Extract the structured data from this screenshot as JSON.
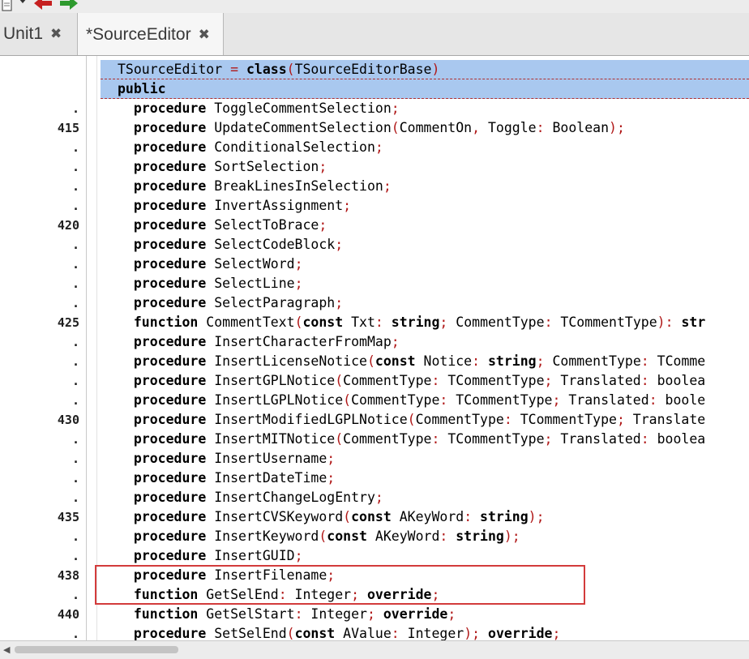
{
  "tabs": [
    {
      "label": "Unit1",
      "active": false
    },
    {
      "label": "*SourceEditor",
      "active": true
    }
  ],
  "editor": {
    "lines": [
      {
        "num": "",
        "highlight": true,
        "tokens": [
          [
            "id",
            "TSourceEditor "
          ],
          [
            "sym",
            "="
          ],
          [
            "id",
            " "
          ],
          [
            "kw",
            "class"
          ],
          [
            "sym",
            "("
          ],
          [
            "id",
            "TSourceEditorBase"
          ],
          [
            "sym",
            ")"
          ]
        ]
      },
      {
        "num": "",
        "highlight": true,
        "tokens": [
          [
            "kw",
            "public"
          ]
        ]
      },
      {
        "num": ".",
        "tokens": [
          [
            "kw",
            "  procedure "
          ],
          [
            "id",
            "ToggleCommentSelection"
          ],
          [
            "sym",
            ";"
          ]
        ]
      },
      {
        "num": "415",
        "tokens": [
          [
            "kw",
            "  procedure "
          ],
          [
            "id",
            "UpdateCommentSelection"
          ],
          [
            "sym",
            "("
          ],
          [
            "id",
            "CommentOn"
          ],
          [
            "sym",
            ","
          ],
          [
            "id",
            " Toggle"
          ],
          [
            "sym",
            ":"
          ],
          [
            "id",
            " Boolean"
          ],
          [
            "sym",
            ");"
          ]
        ]
      },
      {
        "num": ".",
        "tokens": [
          [
            "kw",
            "  procedure "
          ],
          [
            "id",
            "ConditionalSelection"
          ],
          [
            "sym",
            ";"
          ]
        ]
      },
      {
        "num": ".",
        "tokens": [
          [
            "kw",
            "  procedure "
          ],
          [
            "id",
            "SortSelection"
          ],
          [
            "sym",
            ";"
          ]
        ]
      },
      {
        "num": ".",
        "tokens": [
          [
            "kw",
            "  procedure "
          ],
          [
            "id",
            "BreakLinesInSelection"
          ],
          [
            "sym",
            ";"
          ]
        ]
      },
      {
        "num": ".",
        "tokens": [
          [
            "kw",
            "  procedure "
          ],
          [
            "id",
            "InvertAssignment"
          ],
          [
            "sym",
            ";"
          ]
        ]
      },
      {
        "num": "420",
        "tokens": [
          [
            "kw",
            "  procedure "
          ],
          [
            "id",
            "SelectToBrace"
          ],
          [
            "sym",
            ";"
          ]
        ]
      },
      {
        "num": ".",
        "tokens": [
          [
            "kw",
            "  procedure "
          ],
          [
            "id",
            "SelectCodeBlock"
          ],
          [
            "sym",
            ";"
          ]
        ]
      },
      {
        "num": ".",
        "tokens": [
          [
            "kw",
            "  procedure "
          ],
          [
            "id",
            "SelectWord"
          ],
          [
            "sym",
            ";"
          ]
        ]
      },
      {
        "num": ".",
        "tokens": [
          [
            "kw",
            "  procedure "
          ],
          [
            "id",
            "SelectLine"
          ],
          [
            "sym",
            ";"
          ]
        ]
      },
      {
        "num": ".",
        "tokens": [
          [
            "kw",
            "  procedure "
          ],
          [
            "id",
            "SelectParagraph"
          ],
          [
            "sym",
            ";"
          ]
        ]
      },
      {
        "num": "425",
        "tokens": [
          [
            "kw",
            "  function "
          ],
          [
            "id",
            "CommentText"
          ],
          [
            "sym",
            "("
          ],
          [
            "kw",
            "const"
          ],
          [
            "id",
            " Txt"
          ],
          [
            "sym",
            ":"
          ],
          [
            "kw",
            " string"
          ],
          [
            "sym",
            ";"
          ],
          [
            "id",
            " CommentType"
          ],
          [
            "sym",
            ":"
          ],
          [
            "id",
            " TCommentType"
          ],
          [
            "sym",
            "):"
          ],
          [
            "kw",
            " str"
          ]
        ]
      },
      {
        "num": ".",
        "tokens": [
          [
            "kw",
            "  procedure "
          ],
          [
            "id",
            "InsertCharacterFromMap"
          ],
          [
            "sym",
            ";"
          ]
        ]
      },
      {
        "num": ".",
        "tokens": [
          [
            "kw",
            "  procedure "
          ],
          [
            "id",
            "InsertLicenseNotice"
          ],
          [
            "sym",
            "("
          ],
          [
            "kw",
            "const"
          ],
          [
            "id",
            " Notice"
          ],
          [
            "sym",
            ":"
          ],
          [
            "kw",
            " string"
          ],
          [
            "sym",
            ";"
          ],
          [
            "id",
            " CommentType"
          ],
          [
            "sym",
            ":"
          ],
          [
            "id",
            " TComme"
          ]
        ]
      },
      {
        "num": ".",
        "tokens": [
          [
            "kw",
            "  procedure "
          ],
          [
            "id",
            "InsertGPLNotice"
          ],
          [
            "sym",
            "("
          ],
          [
            "id",
            "CommentType"
          ],
          [
            "sym",
            ":"
          ],
          [
            "id",
            " TCommentType"
          ],
          [
            "sym",
            ";"
          ],
          [
            "id",
            " Translated"
          ],
          [
            "sym",
            ":"
          ],
          [
            "id",
            " boolea"
          ]
        ]
      },
      {
        "num": ".",
        "tokens": [
          [
            "kw",
            "  procedure "
          ],
          [
            "id",
            "InsertLGPLNotice"
          ],
          [
            "sym",
            "("
          ],
          [
            "id",
            "CommentType"
          ],
          [
            "sym",
            ":"
          ],
          [
            "id",
            " TCommentType"
          ],
          [
            "sym",
            ";"
          ],
          [
            "id",
            " Translated"
          ],
          [
            "sym",
            ":"
          ],
          [
            "id",
            " boole"
          ]
        ]
      },
      {
        "num": "430",
        "tokens": [
          [
            "kw",
            "  procedure "
          ],
          [
            "id",
            "InsertModifiedLGPLNotice"
          ],
          [
            "sym",
            "("
          ],
          [
            "id",
            "CommentType"
          ],
          [
            "sym",
            ":"
          ],
          [
            "id",
            " TCommentType"
          ],
          [
            "sym",
            ";"
          ],
          [
            "id",
            " Translate"
          ]
        ]
      },
      {
        "num": ".",
        "tokens": [
          [
            "kw",
            "  procedure "
          ],
          [
            "id",
            "InsertMITNotice"
          ],
          [
            "sym",
            "("
          ],
          [
            "id",
            "CommentType"
          ],
          [
            "sym",
            ":"
          ],
          [
            "id",
            " TCommentType"
          ],
          [
            "sym",
            ";"
          ],
          [
            "id",
            " Translated"
          ],
          [
            "sym",
            ":"
          ],
          [
            "id",
            " boolea"
          ]
        ]
      },
      {
        "num": ".",
        "tokens": [
          [
            "kw",
            "  procedure "
          ],
          [
            "id",
            "InsertUsername"
          ],
          [
            "sym",
            ";"
          ]
        ]
      },
      {
        "num": ".",
        "tokens": [
          [
            "kw",
            "  procedure "
          ],
          [
            "id",
            "InsertDateTime"
          ],
          [
            "sym",
            ";"
          ]
        ]
      },
      {
        "num": ".",
        "tokens": [
          [
            "kw",
            "  procedure "
          ],
          [
            "id",
            "InsertChangeLogEntry"
          ],
          [
            "sym",
            ";"
          ]
        ]
      },
      {
        "num": "435",
        "tokens": [
          [
            "kw",
            "  procedure "
          ],
          [
            "id",
            "InsertCVSKeyword"
          ],
          [
            "sym",
            "("
          ],
          [
            "kw",
            "const"
          ],
          [
            "id",
            " AKeyWord"
          ],
          [
            "sym",
            ":"
          ],
          [
            "kw",
            " string"
          ],
          [
            "sym",
            ");"
          ]
        ]
      },
      {
        "num": ".",
        "tokens": [
          [
            "kw",
            "  procedure "
          ],
          [
            "id",
            "InsertKeyword"
          ],
          [
            "sym",
            "("
          ],
          [
            "kw",
            "const"
          ],
          [
            "id",
            " AKeyWord"
          ],
          [
            "sym",
            ":"
          ],
          [
            "kw",
            " string"
          ],
          [
            "sym",
            ");"
          ]
        ]
      },
      {
        "num": ".",
        "tokens": [
          [
            "kw",
            "  procedure "
          ],
          [
            "id",
            "InsertGUID"
          ],
          [
            "sym",
            ";"
          ]
        ]
      },
      {
        "num": "438",
        "tokens": [
          [
            "kw",
            "  procedure "
          ],
          [
            "id",
            "InsertFilename"
          ],
          [
            "sym",
            ";"
          ]
        ]
      },
      {
        "num": ".",
        "tokens": [
          [
            "kw",
            "  function "
          ],
          [
            "id",
            "GetSelEnd"
          ],
          [
            "sym",
            ":"
          ],
          [
            "id",
            " Integer"
          ],
          [
            "sym",
            ";"
          ],
          [
            "kw",
            " override"
          ],
          [
            "sym",
            ";"
          ]
        ]
      },
      {
        "num": "440",
        "tokens": [
          [
            "kw",
            "  function "
          ],
          [
            "id",
            "GetSelStart"
          ],
          [
            "sym",
            ":"
          ],
          [
            "id",
            " Integer"
          ],
          [
            "sym",
            ";"
          ],
          [
            "kw",
            " override"
          ],
          [
            "sym",
            ";"
          ]
        ]
      },
      {
        "num": ".",
        "tokens": [
          [
            "kw",
            "  procedure "
          ],
          [
            "id",
            "SetSelEnd"
          ],
          [
            "sym",
            "("
          ],
          [
            "kw",
            "const"
          ],
          [
            "id",
            " AValue"
          ],
          [
            "sym",
            ":"
          ],
          [
            "id",
            " Integer"
          ],
          [
            "sym",
            ");"
          ],
          [
            "kw",
            " override"
          ],
          [
            "sym",
            ";"
          ]
        ]
      }
    ]
  },
  "icons": {
    "toolbar": [
      "document-icon",
      "dropdown-arrow-icon",
      "back-arrow-icon",
      "forward-arrow-icon"
    ],
    "tab_close": "close-icon"
  },
  "colors": {
    "highlight_line": "#a9c8ef",
    "symbol": "#b01818",
    "annotation_box": "#d33b3b",
    "back_arrow": "#c62020",
    "forward_arrow": "#2e9a2e"
  }
}
